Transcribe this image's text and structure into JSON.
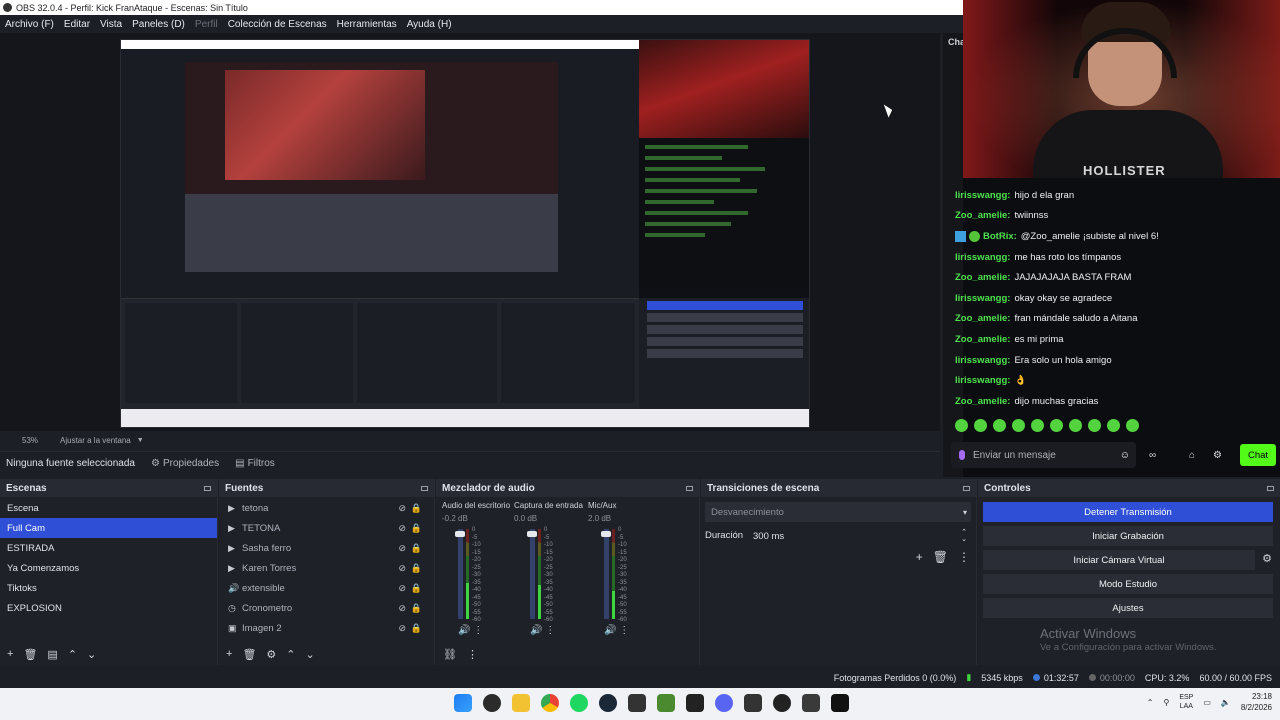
{
  "window": {
    "title": "OBS 32.0.4 - Perfil: Kick FranAtaque - Escenas: Sin Título"
  },
  "menu": [
    {
      "label": "Archivo (F)",
      "disabled": false
    },
    {
      "label": "Editar",
      "disabled": false
    },
    {
      "label": "Vista",
      "disabled": false
    },
    {
      "label": "Paneles (D)",
      "disabled": false
    },
    {
      "label": "Perfil",
      "disabled": true
    },
    {
      "label": "Colección de Escenas",
      "disabled": false
    },
    {
      "label": "Herramientas",
      "disabled": false
    },
    {
      "label": "Ayuda (H)",
      "disabled": false
    }
  ],
  "zoom": {
    "level": "53%",
    "fit_label": "Ajustar a la ventana"
  },
  "context": {
    "no_source": "Ninguna fuente seleccionada",
    "properties": "Propiedades",
    "filters": "Filtros"
  },
  "chat": {
    "tab": "Cha",
    "messages": [
      {
        "user": "lirisswangg:",
        "text": "hijo d ela gran",
        "bot": false
      },
      {
        "user": "Zoo_amelie:",
        "text": "twiinnss",
        "bot": false
      },
      {
        "user": "BotRix:",
        "text": "@Zoo_amelie ¡subiste al nivel 6!",
        "bot": true
      },
      {
        "user": "lirisswangg:",
        "text": "me has roto los tímpanos",
        "bot": false
      },
      {
        "user": "Zoo_amelie:",
        "text": "JAJAJAJAJA BASTA FRAM",
        "bot": false
      },
      {
        "user": "lirisswangg:",
        "text": "okay okay se agradece",
        "bot": false
      },
      {
        "user": "Zoo_amelie:",
        "text": "fran mándale saludo a Aitana",
        "bot": false
      },
      {
        "user": "Zoo_amelie:",
        "text": "es mi prima",
        "bot": false
      },
      {
        "user": "lirisswangg:",
        "text": "Era solo un hola amigo",
        "bot": false
      },
      {
        "user": "lirisswangg:",
        "text": "👌",
        "bot": false
      },
      {
        "user": "Zoo_amelie:",
        "text": "dijo muchas gracias",
        "bot": false
      }
    ],
    "input_placeholder": "Enviar un mensaje",
    "send_label": "Chat"
  },
  "webcam": {
    "shirt_brand": "HOLLISTER"
  },
  "scenes": {
    "title": "Escenas",
    "items": [
      "Escena",
      "Full Cam",
      "ESTIRADA",
      "Ya Comenzamos",
      "Tiktoks",
      "EXPLOSION"
    ],
    "selected_index": 1
  },
  "sources": {
    "title": "Fuentes",
    "items": [
      {
        "label": "tetona",
        "icon": "play-icon"
      },
      {
        "label": "TETONA",
        "icon": "play-icon"
      },
      {
        "label": "Sasha ferro",
        "icon": "play-icon"
      },
      {
        "label": "Karen Torres",
        "icon": "play-icon"
      },
      {
        "label": "extensible",
        "icon": "audio-output-icon"
      },
      {
        "label": "Cronometro",
        "icon": "clock-icon"
      },
      {
        "label": "Imagen 2",
        "icon": "image-icon"
      }
    ]
  },
  "mixer": {
    "title": "Mezclador de audio",
    "channels": [
      {
        "name": "Audio del escritorio",
        "db": "-0.2 dB",
        "level": 0.9
      },
      {
        "name": "Captura de entrada",
        "db": "0.0 dB",
        "level": 0.85
      },
      {
        "name": "Mic/Aux",
        "db": "2.0 dB",
        "level": 0.7
      }
    ],
    "scale": [
      "0",
      "-5",
      "-10",
      "-15",
      "-20",
      "-25",
      "-30",
      "-35",
      "-40",
      "-45",
      "-50",
      "-55",
      "-60"
    ]
  },
  "transitions": {
    "title": "Transiciones de escena",
    "selected": "Desvanecimiento",
    "duration_label": "Duración",
    "duration_value": "300 ms"
  },
  "controls": {
    "title": "Controles",
    "buttons": [
      {
        "label": "Detener Transmisión",
        "primary": true
      },
      {
        "label": "Iniciar Grabación",
        "primary": false
      },
      {
        "label": "Iniciar Cámara Virtual",
        "primary": false
      },
      {
        "label": "Modo Estudio",
        "primary": false
      },
      {
        "label": "Ajustes",
        "primary": false
      }
    ],
    "watermark_title": "Activar Windows",
    "watermark_sub": "Ve a Configuración para activar Windows."
  },
  "status": {
    "dropped_frames": "Fotogramas Perdidos 0 (0.0%)",
    "bitrate": "5345 kbps",
    "stream_time": "01:32:57",
    "rec_time": "00:00:00",
    "cpu": "CPU: 3.2%",
    "fps": "60.00 / 60.00 FPS"
  },
  "taskbar": {
    "lang_top": "ESP",
    "lang_bottom": "LAA",
    "time": "23:18",
    "date": "8/2/2026"
  }
}
